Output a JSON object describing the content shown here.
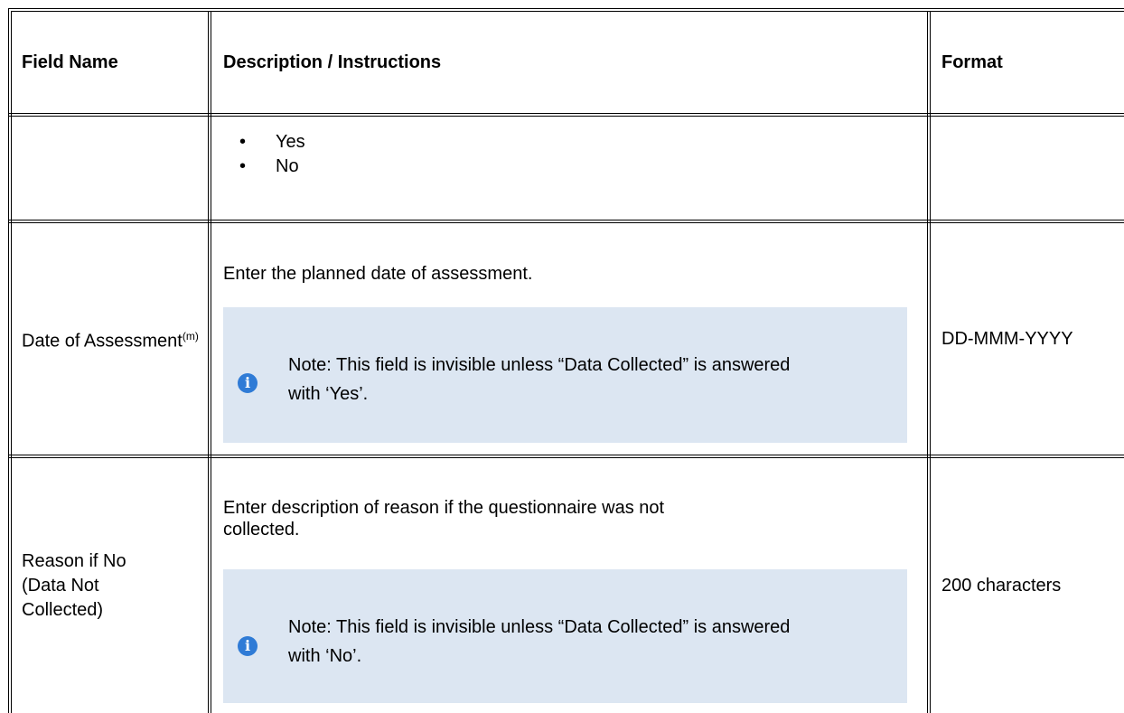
{
  "headers": {
    "field_name": "Field Name",
    "description": "Description / Instructions",
    "format": "Format"
  },
  "rows": [
    {
      "field_name": "",
      "options": [
        "Yes",
        "No"
      ],
      "format": ""
    },
    {
      "field_name": "Date of Assessment",
      "field_superscript": "(m)",
      "description": "Enter the planned date of assessment.",
      "note": "Note: This field is invisible unless “Data Collected” is answered with ‘Yes’.",
      "format": "DD-MMM-YYYY"
    },
    {
      "field_name_lines": [
        "Reason if No",
        "(Data Not",
        "Collected)"
      ],
      "description": "Enter description of reason if the questionnaire was not collected.",
      "note": "Note: This field is invisible unless “Data Collected” is answered with ‘No’.",
      "format": "200 characters"
    }
  ],
  "icons": {
    "note": "info-icon",
    "note_glyph": "i"
  },
  "colors": {
    "note_background": "#dce6f2",
    "info_icon": "#2f7bd6"
  }
}
